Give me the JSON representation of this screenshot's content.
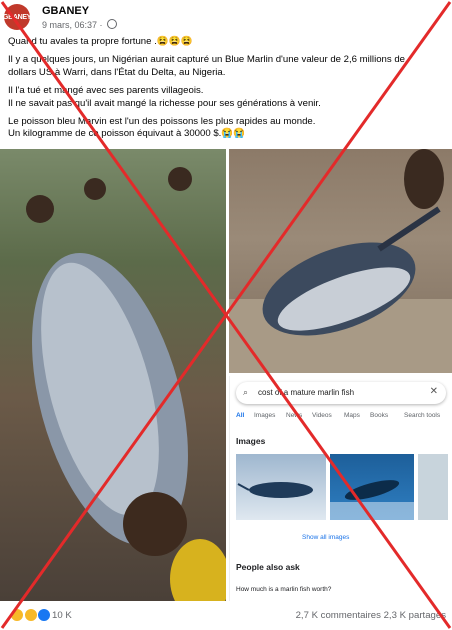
{
  "post": {
    "avatar_text": "GBANEY",
    "author": "GBANEY",
    "date": "9 mars, 06:37 ·",
    "privacy_icon": "globe-icon",
    "paragraphs": [
      [
        "Quand tu avales ta propre fortune .😫😫😫"
      ],
      [
        "Il y a quelques jours, un Nigérian aurait capturé un Blue Marlin d'une valeur de 2,6 millions de",
        "dollars US à Warri, dans l'État du Delta, au Nigeria."
      ],
      [
        " Il l'a tué et mangé avec ses parents villageois.",
        "Il ne savait pas qu'il avait mangé la richesse pour ses générations à venir."
      ],
      [
        "Le poisson bleu Marvin est l'un des poissons les plus rapides au monde.",
        "Un kilogramme de ce poisson équivaut à 30000 $.😭😭"
      ]
    ]
  },
  "search_screenshot": {
    "query": "cost of a mature marlin fish",
    "tabs": [
      "All",
      "Images",
      "News",
      "Videos",
      "Maps",
      "Books",
      "Search tools"
    ],
    "active_tab": "All",
    "images_heading": "Images",
    "show_all": "Show all images",
    "people_also_ask": "People also ask",
    "question": "How much is a marlin fish worth?"
  },
  "footer": {
    "reactions": [
      "haha",
      "wow",
      "like"
    ],
    "reaction_count": "10 K",
    "comments": "2,7 K commentaires",
    "shares": "2,3 K partages"
  },
  "colors": {
    "cross": "#e32a2a",
    "link_blue": "#1a73e8",
    "meta_gray": "#65676b"
  }
}
